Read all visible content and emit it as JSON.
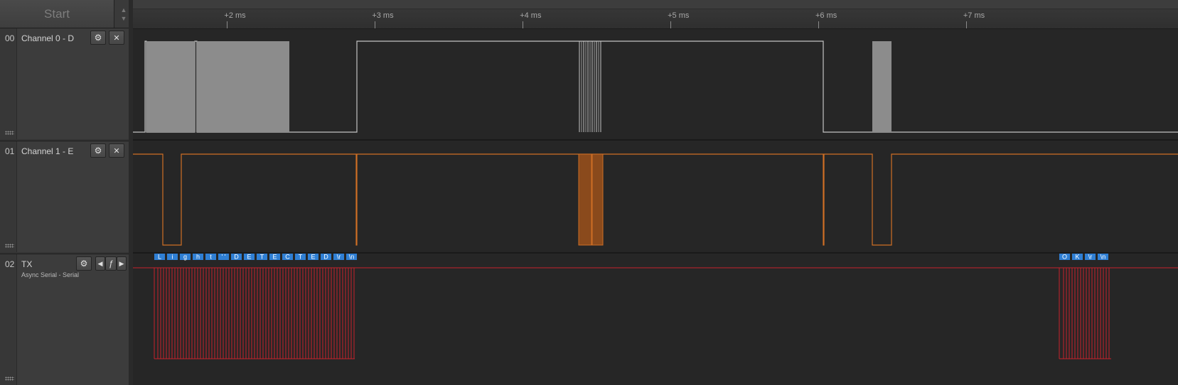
{
  "start_button": {
    "label": "Start",
    "arrows_up": "▲",
    "arrows_down": "▼"
  },
  "ruler": {
    "ticks": [
      "+2 ms",
      "+3 ms",
      "+4 ms",
      "+5 ms",
      "+6 ms",
      "+7 ms"
    ],
    "tick_ms": [
      2,
      3,
      4,
      5,
      6,
      7
    ]
  },
  "channels": [
    {
      "number": "00",
      "name": "Channel 0 - D",
      "subtitle": "",
      "color": "#c4c4c4",
      "fill": "#8c8c8c",
      "gear_icon": "⚙",
      "close_icon": "✕"
    },
    {
      "number": "01",
      "name": "Channel 1 - E",
      "subtitle": "",
      "color": "#cf6f25",
      "fill": "#8a4a1c",
      "gear_icon": "⚙",
      "close_icon": "✕"
    },
    {
      "number": "02",
      "name": "TX",
      "subtitle": "Async Serial - Serial",
      "color": "#c8222c",
      "gear_icon": "⚙",
      "prev_icon": "◀",
      "edge_icon": "ƒ",
      "next_icon": "▶"
    }
  ],
  "decoded_bytes": [
    "L",
    "i",
    "g",
    "h",
    "t",
    "' '",
    "D",
    "E",
    "T",
    "E",
    "C",
    "T",
    "E",
    "D",
    "\\r",
    "\\n",
    "O",
    "K",
    "\\r",
    "\\n"
  ],
  "decoded_color": "#2f7fd4",
  "timebase": {
    "start_ms": 1.363,
    "end_ms": 8.434
  }
}
